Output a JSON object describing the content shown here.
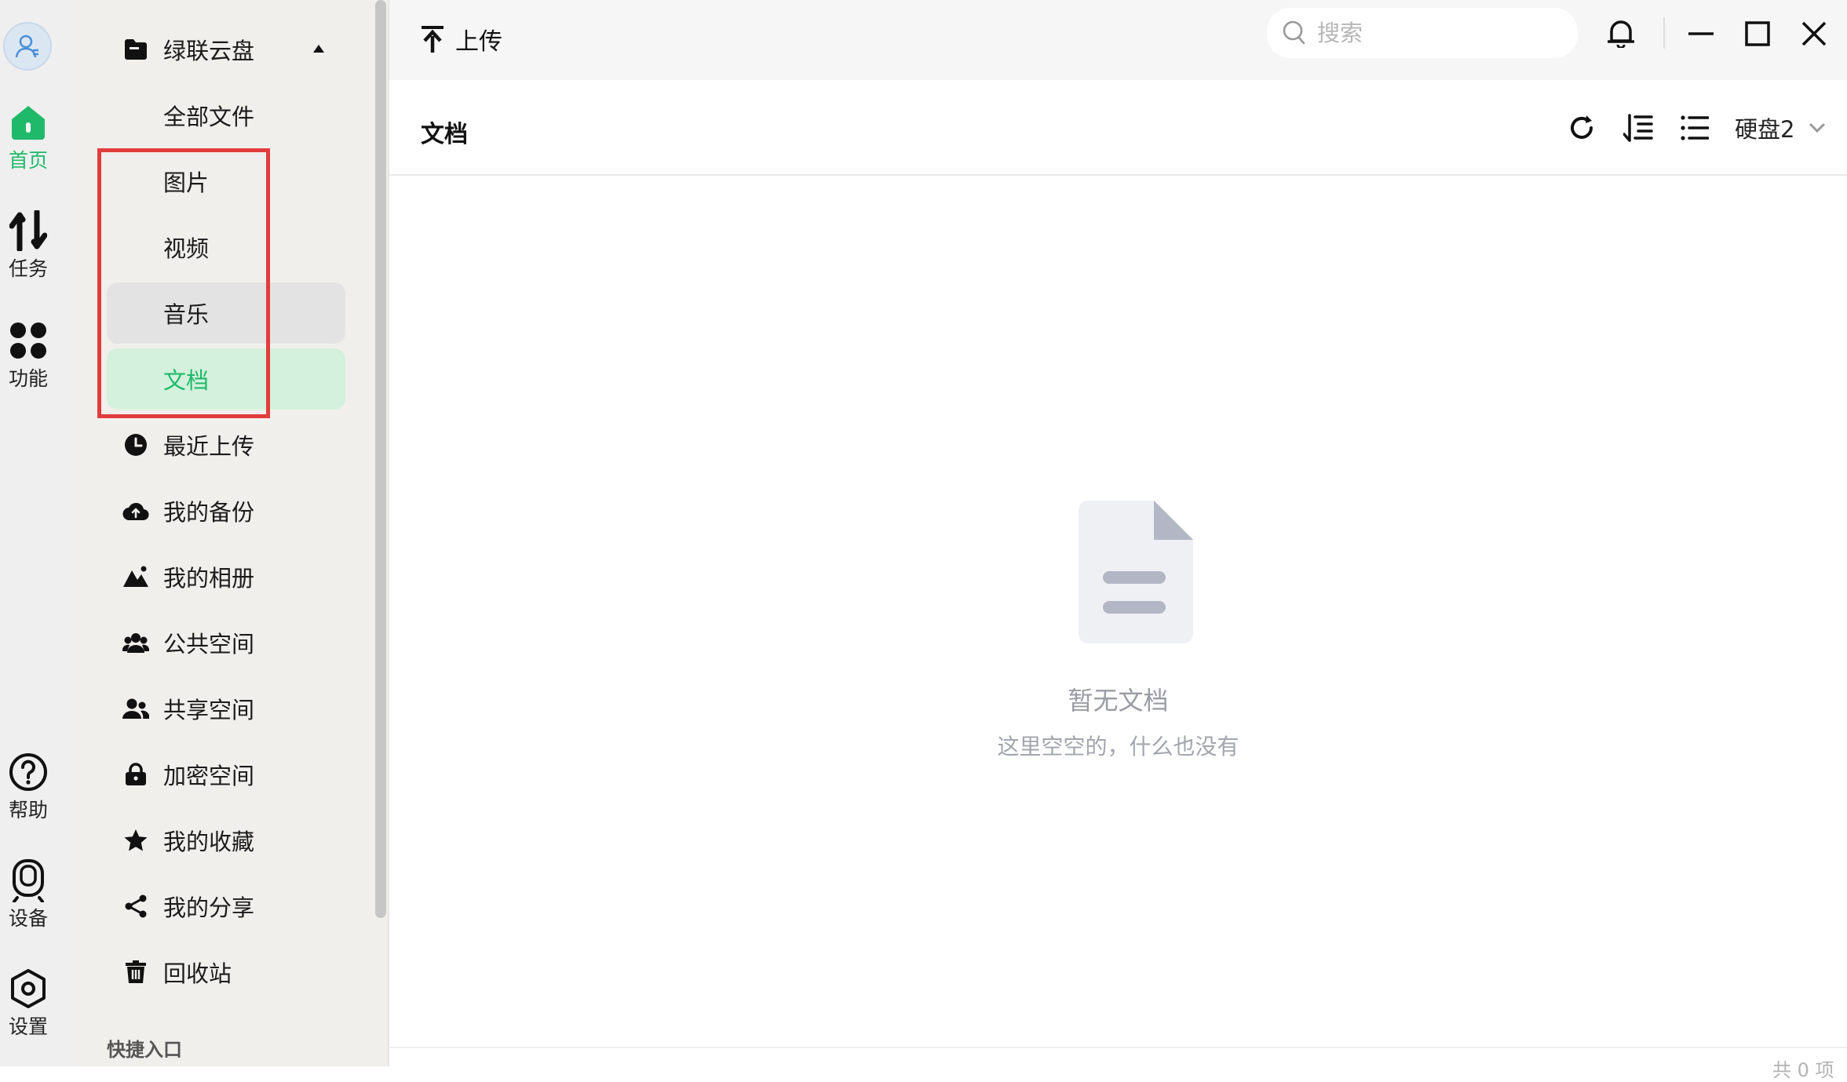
{
  "rail": {
    "items": [
      {
        "label": "首页",
        "icon": "home-icon",
        "active": true
      },
      {
        "label": "任务",
        "icon": "transfer-arrows-icon"
      },
      {
        "label": "功能",
        "icon": "grid-dots-icon"
      },
      {
        "label": "帮助",
        "icon": "help-circle-icon"
      },
      {
        "label": "设备",
        "icon": "device-icon"
      },
      {
        "label": "设置",
        "icon": "settings-hex-icon"
      }
    ],
    "accent": "#1fb96a"
  },
  "sidebar": {
    "cloud": {
      "label": "绿联云盘",
      "expanded": true
    },
    "sub_items": [
      {
        "label": "全部文件"
      },
      {
        "label": "图片"
      },
      {
        "label": "视频"
      },
      {
        "label": "音乐",
        "state": "hover"
      },
      {
        "label": "文档",
        "state": "selected"
      }
    ],
    "items": [
      {
        "label": "最近上传",
        "icon": "clock-icon"
      },
      {
        "label": "我的备份",
        "icon": "cloud-upload-icon"
      },
      {
        "label": "我的相册",
        "icon": "mountain-photo-icon"
      },
      {
        "label": "公共空间",
        "icon": "group-icon"
      },
      {
        "label": "共享空间",
        "icon": "users-icon"
      },
      {
        "label": "加密空间",
        "icon": "lock-icon"
      },
      {
        "label": "我的收藏",
        "icon": "star-icon"
      },
      {
        "label": "我的分享",
        "icon": "share-icon"
      },
      {
        "label": "回收站",
        "icon": "trash-icon"
      }
    ],
    "quick_title": "快捷入口"
  },
  "topbar": {
    "upload_label": "上传",
    "search_placeholder": "搜索"
  },
  "content": {
    "title": "文档",
    "disk_label": "硬盘2",
    "empty_title": "暂无文档",
    "empty_subtitle": "这里空空的，什么也没有",
    "item_count": "共 0 项"
  },
  "annotation": {
    "color": "#e23d3d"
  }
}
